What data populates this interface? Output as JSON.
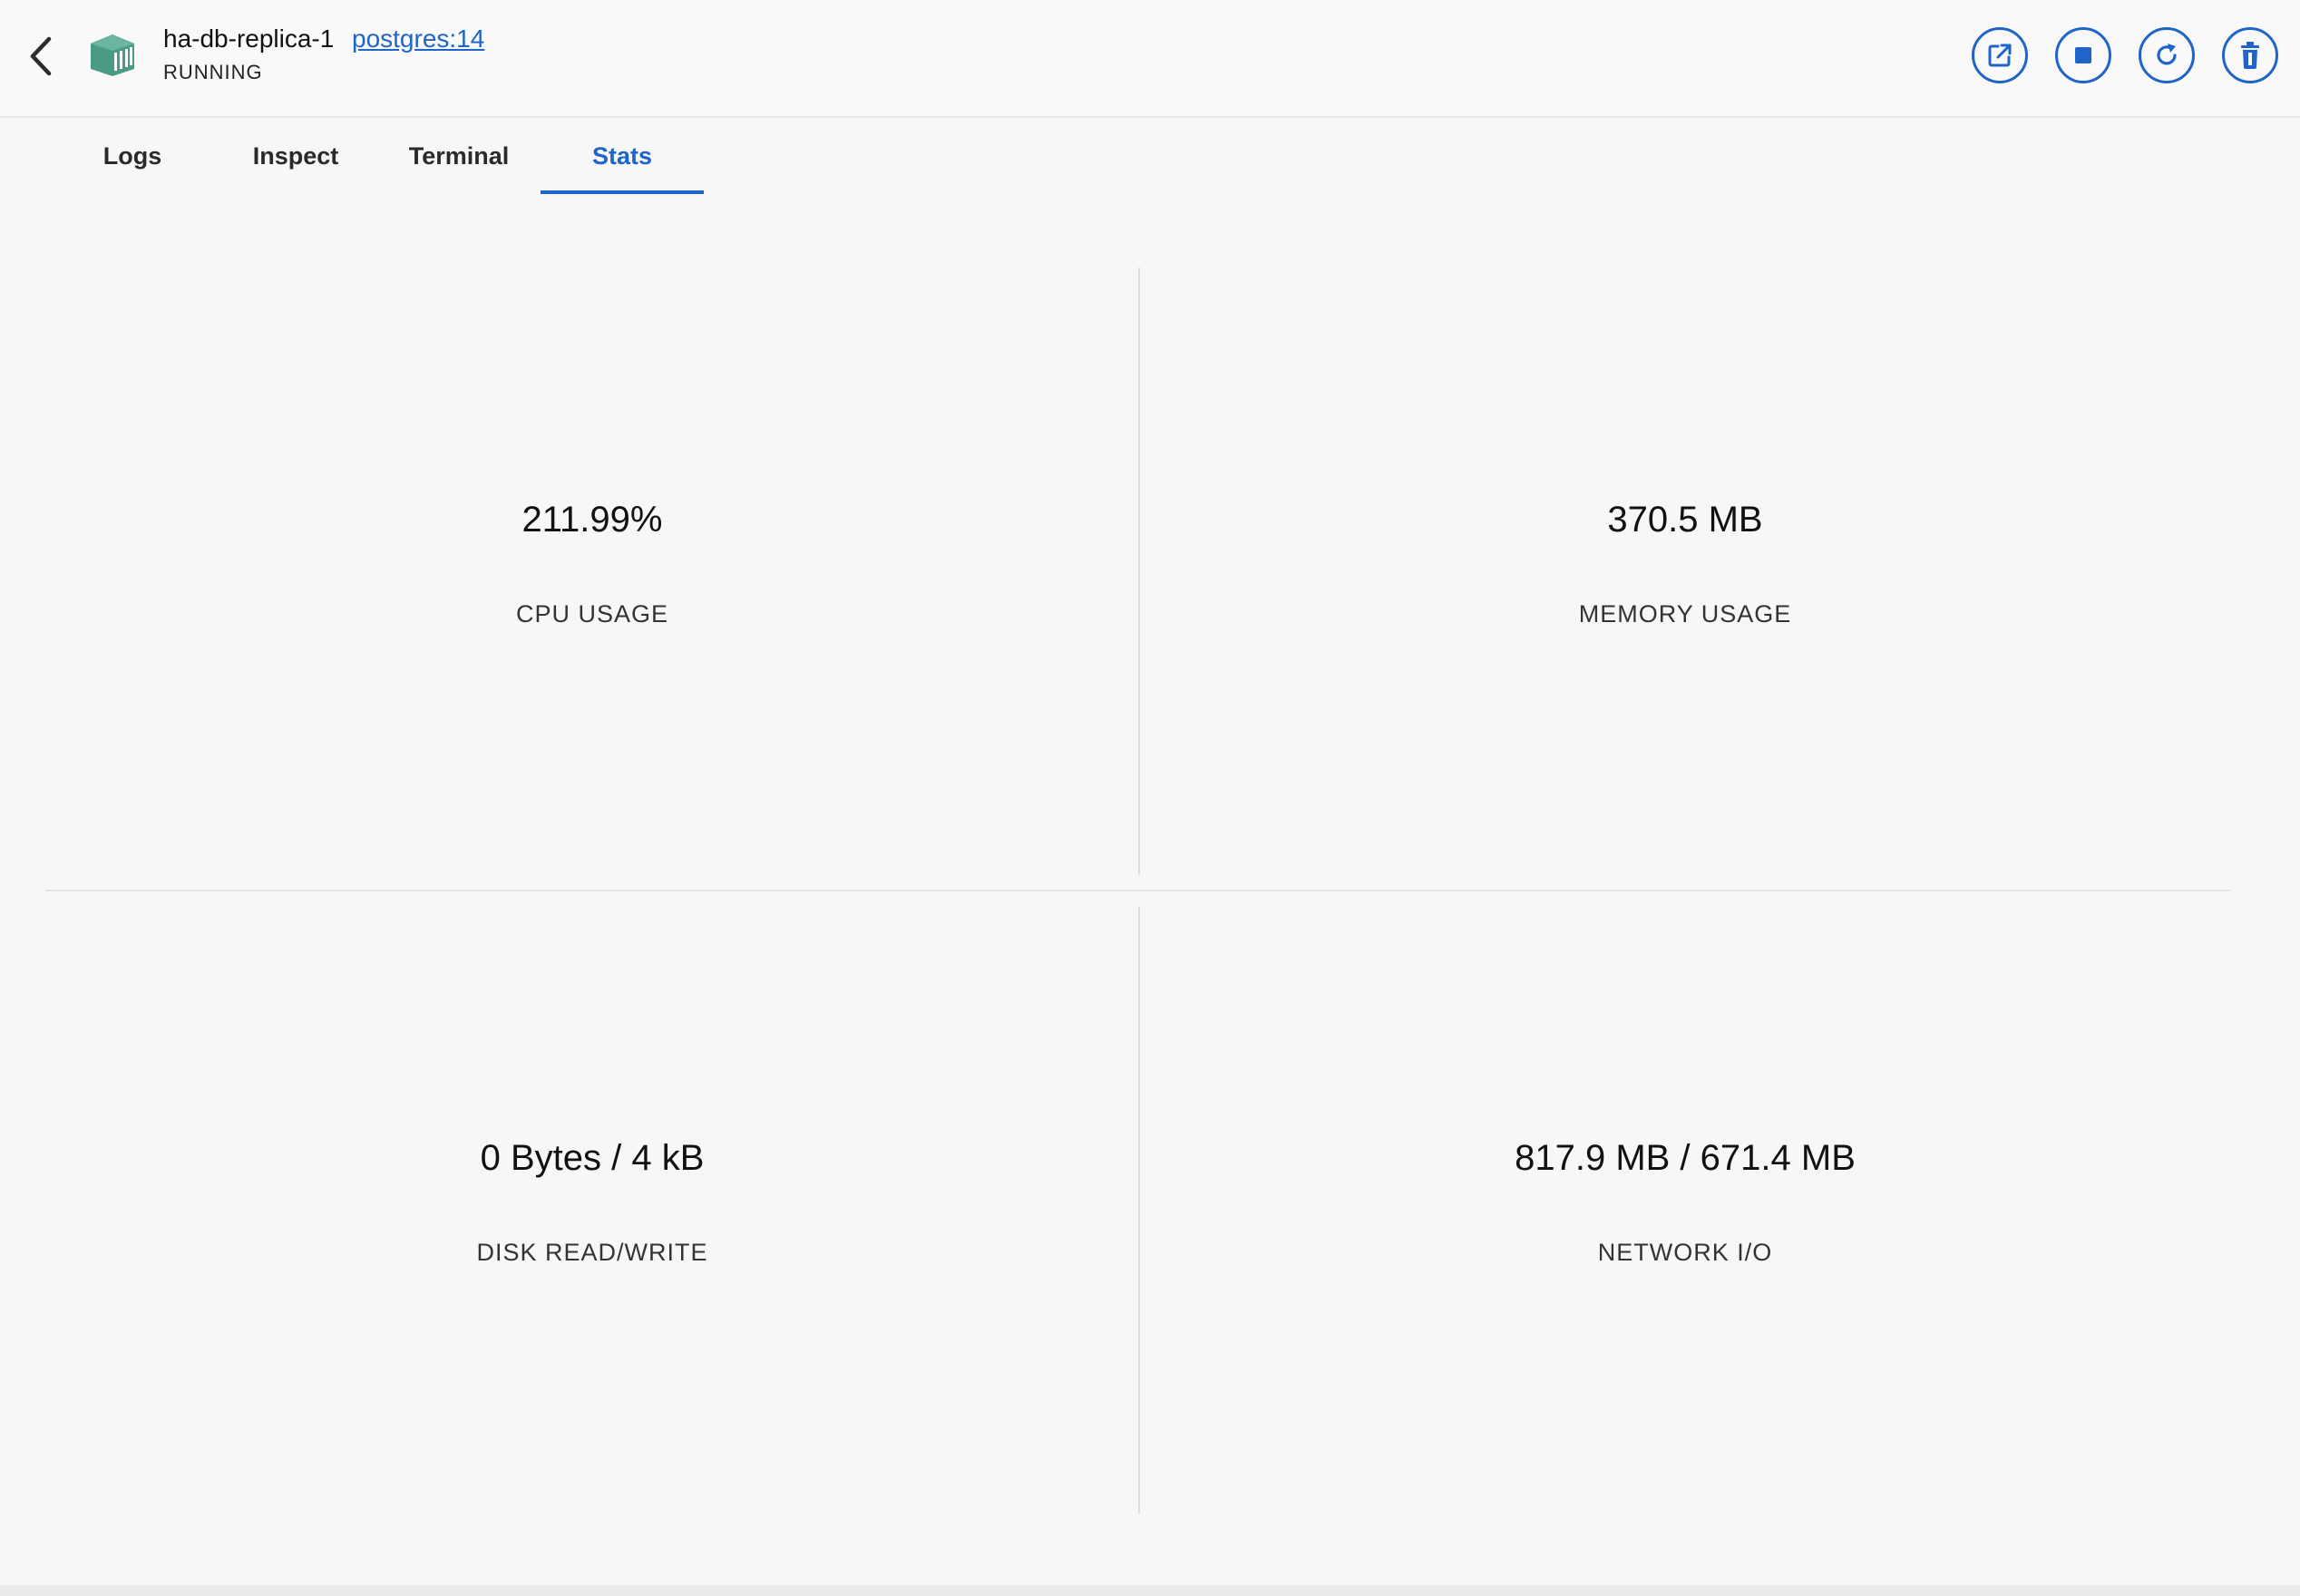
{
  "header": {
    "container_name": "ha-db-replica-1",
    "image": "postgres:14",
    "status": "RUNNING",
    "back_icon": "chevron-left-icon",
    "container_icon": "container-box-icon",
    "accent_color": "#1f64c8",
    "container_icon_color": "#4a9b86",
    "actions": [
      {
        "name": "open-in-browser",
        "icon": "external-link-icon"
      },
      {
        "name": "stop",
        "icon": "stop-icon"
      },
      {
        "name": "restart",
        "icon": "restart-icon"
      },
      {
        "name": "delete",
        "icon": "trash-icon"
      }
    ]
  },
  "tabs": [
    {
      "label": "Logs",
      "active": false
    },
    {
      "label": "Inspect",
      "active": false
    },
    {
      "label": "Terminal",
      "active": false
    },
    {
      "label": "Stats",
      "active": true
    }
  ],
  "stats": {
    "cpu": {
      "value": "211.99%",
      "label": "CPU USAGE"
    },
    "memory": {
      "value": "370.5 MB",
      "label": "MEMORY USAGE"
    },
    "disk": {
      "value": "0 Bytes / 4 kB",
      "label": "DISK READ/WRITE"
    },
    "network": {
      "value": "817.9 MB / 671.4 MB",
      "label": "NETWORK I/O"
    }
  }
}
